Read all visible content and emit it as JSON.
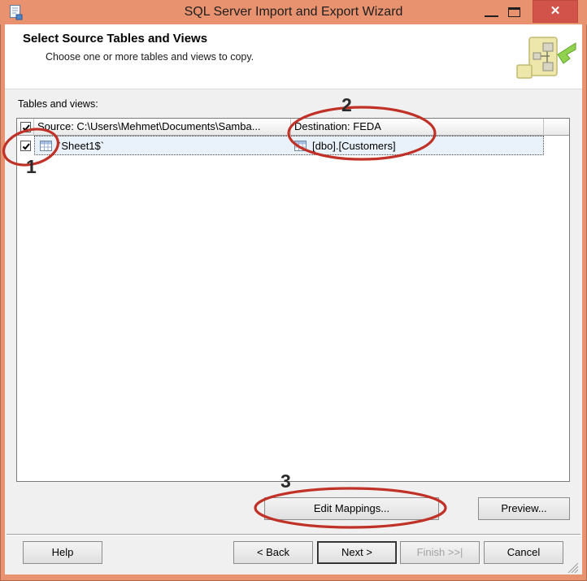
{
  "window": {
    "title": "SQL Server Import and Export Wizard",
    "close_glyph": "✕"
  },
  "header": {
    "title": "Select Source Tables and Views",
    "subtitle": "Choose one or more tables and views to copy."
  },
  "main": {
    "tables_label": "Tables and views:",
    "grid": {
      "source_header": "Source: C:\\Users\\Mehmet\\Documents\\Samba...",
      "destination_header": "Destination: FEDA",
      "header_checked": true,
      "rows": [
        {
          "checked": true,
          "source": "`Sheet1$`",
          "destination": "[dbo].[Customers]"
        }
      ]
    },
    "edit_mappings_label": "Edit Mappings...",
    "preview_label": "Preview..."
  },
  "footer": {
    "help": "Help",
    "back": "< Back",
    "next": "Next >",
    "finish": "Finish >>|",
    "cancel": "Cancel"
  },
  "annotations": {
    "color": "#C03227",
    "number_color": "#2B2B2B",
    "items": [
      {
        "number": "1"
      },
      {
        "number": "2"
      },
      {
        "number": "3"
      }
    ]
  },
  "colors": {
    "titlebar": "#E8926F",
    "close_button": "#D15349",
    "selection": "#E9F1FB",
    "body": "#F0F0F0"
  }
}
